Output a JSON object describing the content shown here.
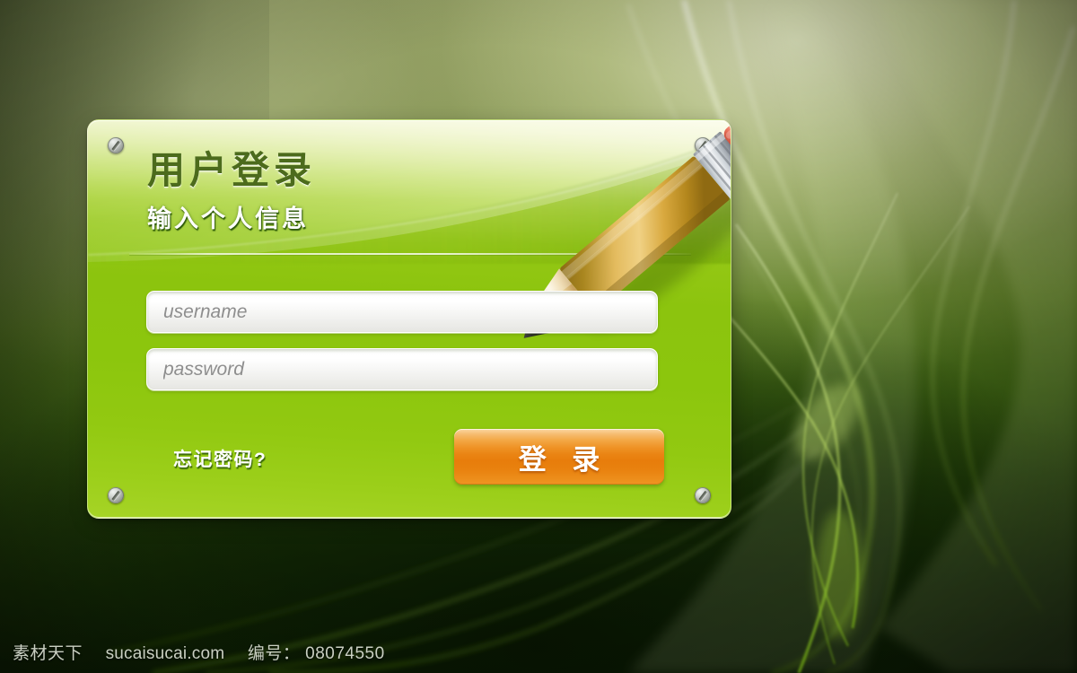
{
  "panel": {
    "title": "用户登录",
    "subtitle": "输入个人信息",
    "screws": [
      "screw-top-left",
      "screw-top-right",
      "screw-bottom-left",
      "screw-bottom-right"
    ],
    "decor_icon": "pencil-icon"
  },
  "form": {
    "username": {
      "placeholder": "username",
      "value": ""
    },
    "password": {
      "placeholder": "password",
      "value": ""
    },
    "forgot_label": "忘记密码?",
    "submit_label": "登 录"
  },
  "watermark": {
    "brand": "素材天下",
    "site": "sucaisucai.com",
    "id_label": "编号：",
    "id_value": "08074550"
  },
  "colors": {
    "panel_light": "#f3f7c8",
    "panel_green": "#8cc40e",
    "title_green": "#4c6b1c",
    "button_orange": "#e87d0b",
    "button_orange_light": "#fbd8a4",
    "background_olive": "#9aa469",
    "background_dark": "#081803",
    "placeholder_gray": "#8e8e8e"
  }
}
